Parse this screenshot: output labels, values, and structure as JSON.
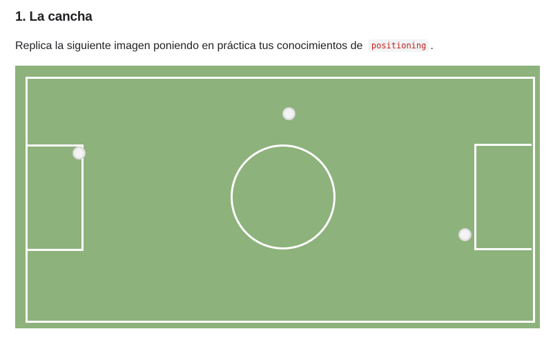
{
  "heading": {
    "title": "1. La cancha"
  },
  "instructions": {
    "text_before": "Replica la siguiente imagen poniendo en práctica tus conocimientos de",
    "code": "positioning",
    "text_after": "."
  },
  "field": {
    "colors": {
      "grass": "#8db27c",
      "lines": "#ffffff",
      "ball": "#f4f4f4"
    },
    "balls_count": 3
  }
}
